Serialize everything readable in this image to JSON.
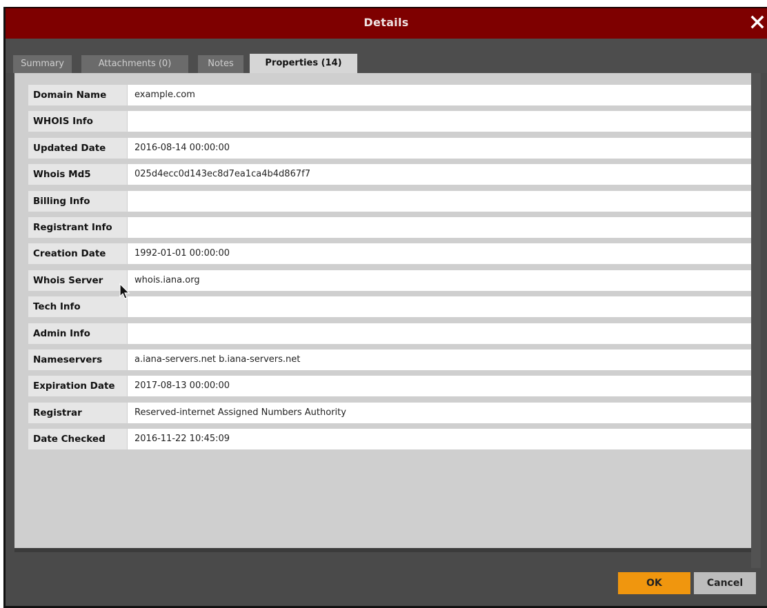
{
  "window": {
    "title": "Details",
    "close_icon": "close-icon"
  },
  "tabs": [
    {
      "label": "Summary",
      "active": false
    },
    {
      "label": "Attachments (0)",
      "active": false
    },
    {
      "label": "Notes",
      "active": false
    },
    {
      "label": "Properties (14)",
      "active": true
    }
  ],
  "properties": [
    {
      "label": "Domain Name",
      "value": "example.com"
    },
    {
      "label": "WHOIS Info",
      "value": ""
    },
    {
      "label": "Updated Date",
      "value": "2016-08-14 00:00:00"
    },
    {
      "label": "Whois Md5",
      "value": "025d4ecc0d143ec8d7ea1ca4b4d867f7"
    },
    {
      "label": "Billing Info",
      "value": ""
    },
    {
      "label": "Registrant Info",
      "value": ""
    },
    {
      "label": "Creation Date",
      "value": "1992-01-01 00:00:00"
    },
    {
      "label": "Whois Server",
      "value": "whois.iana.org"
    },
    {
      "label": "Tech Info",
      "value": ""
    },
    {
      "label": "Admin Info",
      "value": ""
    },
    {
      "label": "Nameservers",
      "value": "a.iana-servers.net b.iana-servers.net"
    },
    {
      "label": "Expiration Date",
      "value": "2017-08-13 00:00:00"
    },
    {
      "label": "Registrar",
      "value": "Reserved-internet Assigned Numbers Authority"
    },
    {
      "label": "Date Checked",
      "value": "2016-11-22 10:45:09"
    }
  ],
  "footer": {
    "ok_label": "OK",
    "cancel_label": "Cancel"
  },
  "colors": {
    "titlebar": "#7e0000",
    "ok_button": "#f0960e",
    "cancel_button": "#bdbdbd"
  }
}
